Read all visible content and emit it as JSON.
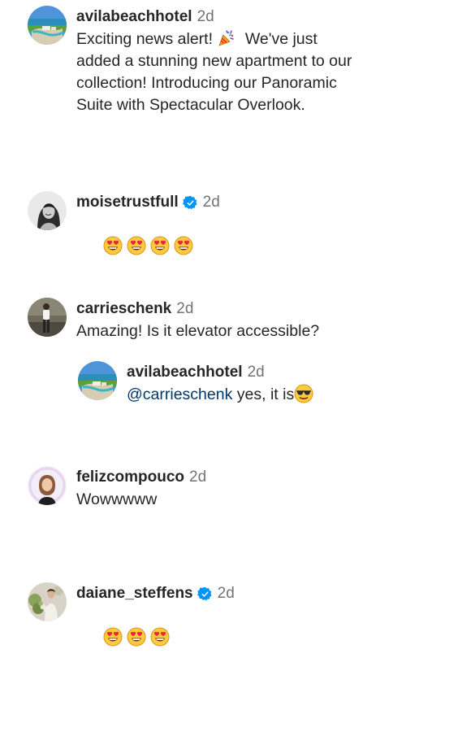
{
  "comments": [
    {
      "username": "avilabeachhotel",
      "time": "2d",
      "verified": false,
      "text_1": "Exciting news alert! ",
      "text_2": " We've just added a stunning new apartment to our collection! Introducing our Panoramic Suite with Spectacular Overlook.",
      "icon": "party-popper-icon"
    },
    {
      "username": "moisetrustfull",
      "time": "2d",
      "verified": true,
      "emojis": [
        "heart-eyes-icon",
        "heart-eyes-icon",
        "heart-eyes-icon",
        "heart-eyes-icon"
      ]
    },
    {
      "username": "carrieschenk",
      "time": "2d",
      "verified": false,
      "text": "Amazing! Is it elevator accessible?"
    },
    {
      "username": "felizcompouco",
      "time": "2d",
      "verified": false,
      "text": "Wowwwww"
    },
    {
      "username": "daiane_steffens",
      "time": "2d",
      "verified": true,
      "emojis": [
        "heart-eyes-icon",
        "heart-eyes-icon",
        "heart-eyes-icon"
      ]
    }
  ],
  "reply": {
    "username": "avilabeachhotel",
    "time": "2d",
    "mention": "@carrieschenk",
    "text": " yes, it is",
    "icon": "sunglasses-face-icon"
  },
  "colors": {
    "text": "#262626",
    "secondary": "#737373",
    "mention": "#00376b",
    "verified": "#0095f6"
  }
}
